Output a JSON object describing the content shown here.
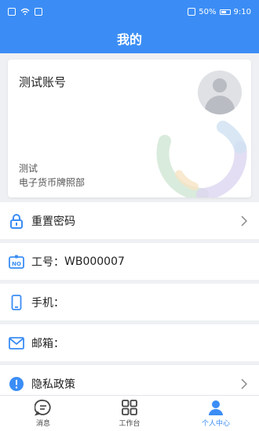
{
  "status_bar": {
    "battery": "50%",
    "time": "9:10"
  },
  "header": {
    "title": "我的"
  },
  "profile": {
    "account_name": "测试账号",
    "role": "测试",
    "department": "电子货币牌照部"
  },
  "menu": [
    {
      "label": "重置密码",
      "value": "",
      "icon": "lock-icon",
      "chevron": true
    },
    {
      "label": "工号：",
      "value": "WB000007",
      "icon": "id-badge-icon",
      "chevron": false
    },
    {
      "label": "手机：",
      "value": "",
      "icon": "phone-icon",
      "chevron": false
    },
    {
      "label": "邮箱：",
      "value": "",
      "icon": "mail-icon",
      "chevron": false
    },
    {
      "label": "隐私政策",
      "value": "",
      "icon": "info-icon",
      "chevron": true
    }
  ],
  "tabs": [
    {
      "label": "消息",
      "icon": "message-icon",
      "active": false
    },
    {
      "label": "工作台",
      "icon": "grid-icon",
      "active": false
    },
    {
      "label": "个人中心",
      "icon": "person-icon",
      "active": true
    }
  ],
  "colors": {
    "primary": "#3b8df5",
    "background": "#eef0f3"
  }
}
